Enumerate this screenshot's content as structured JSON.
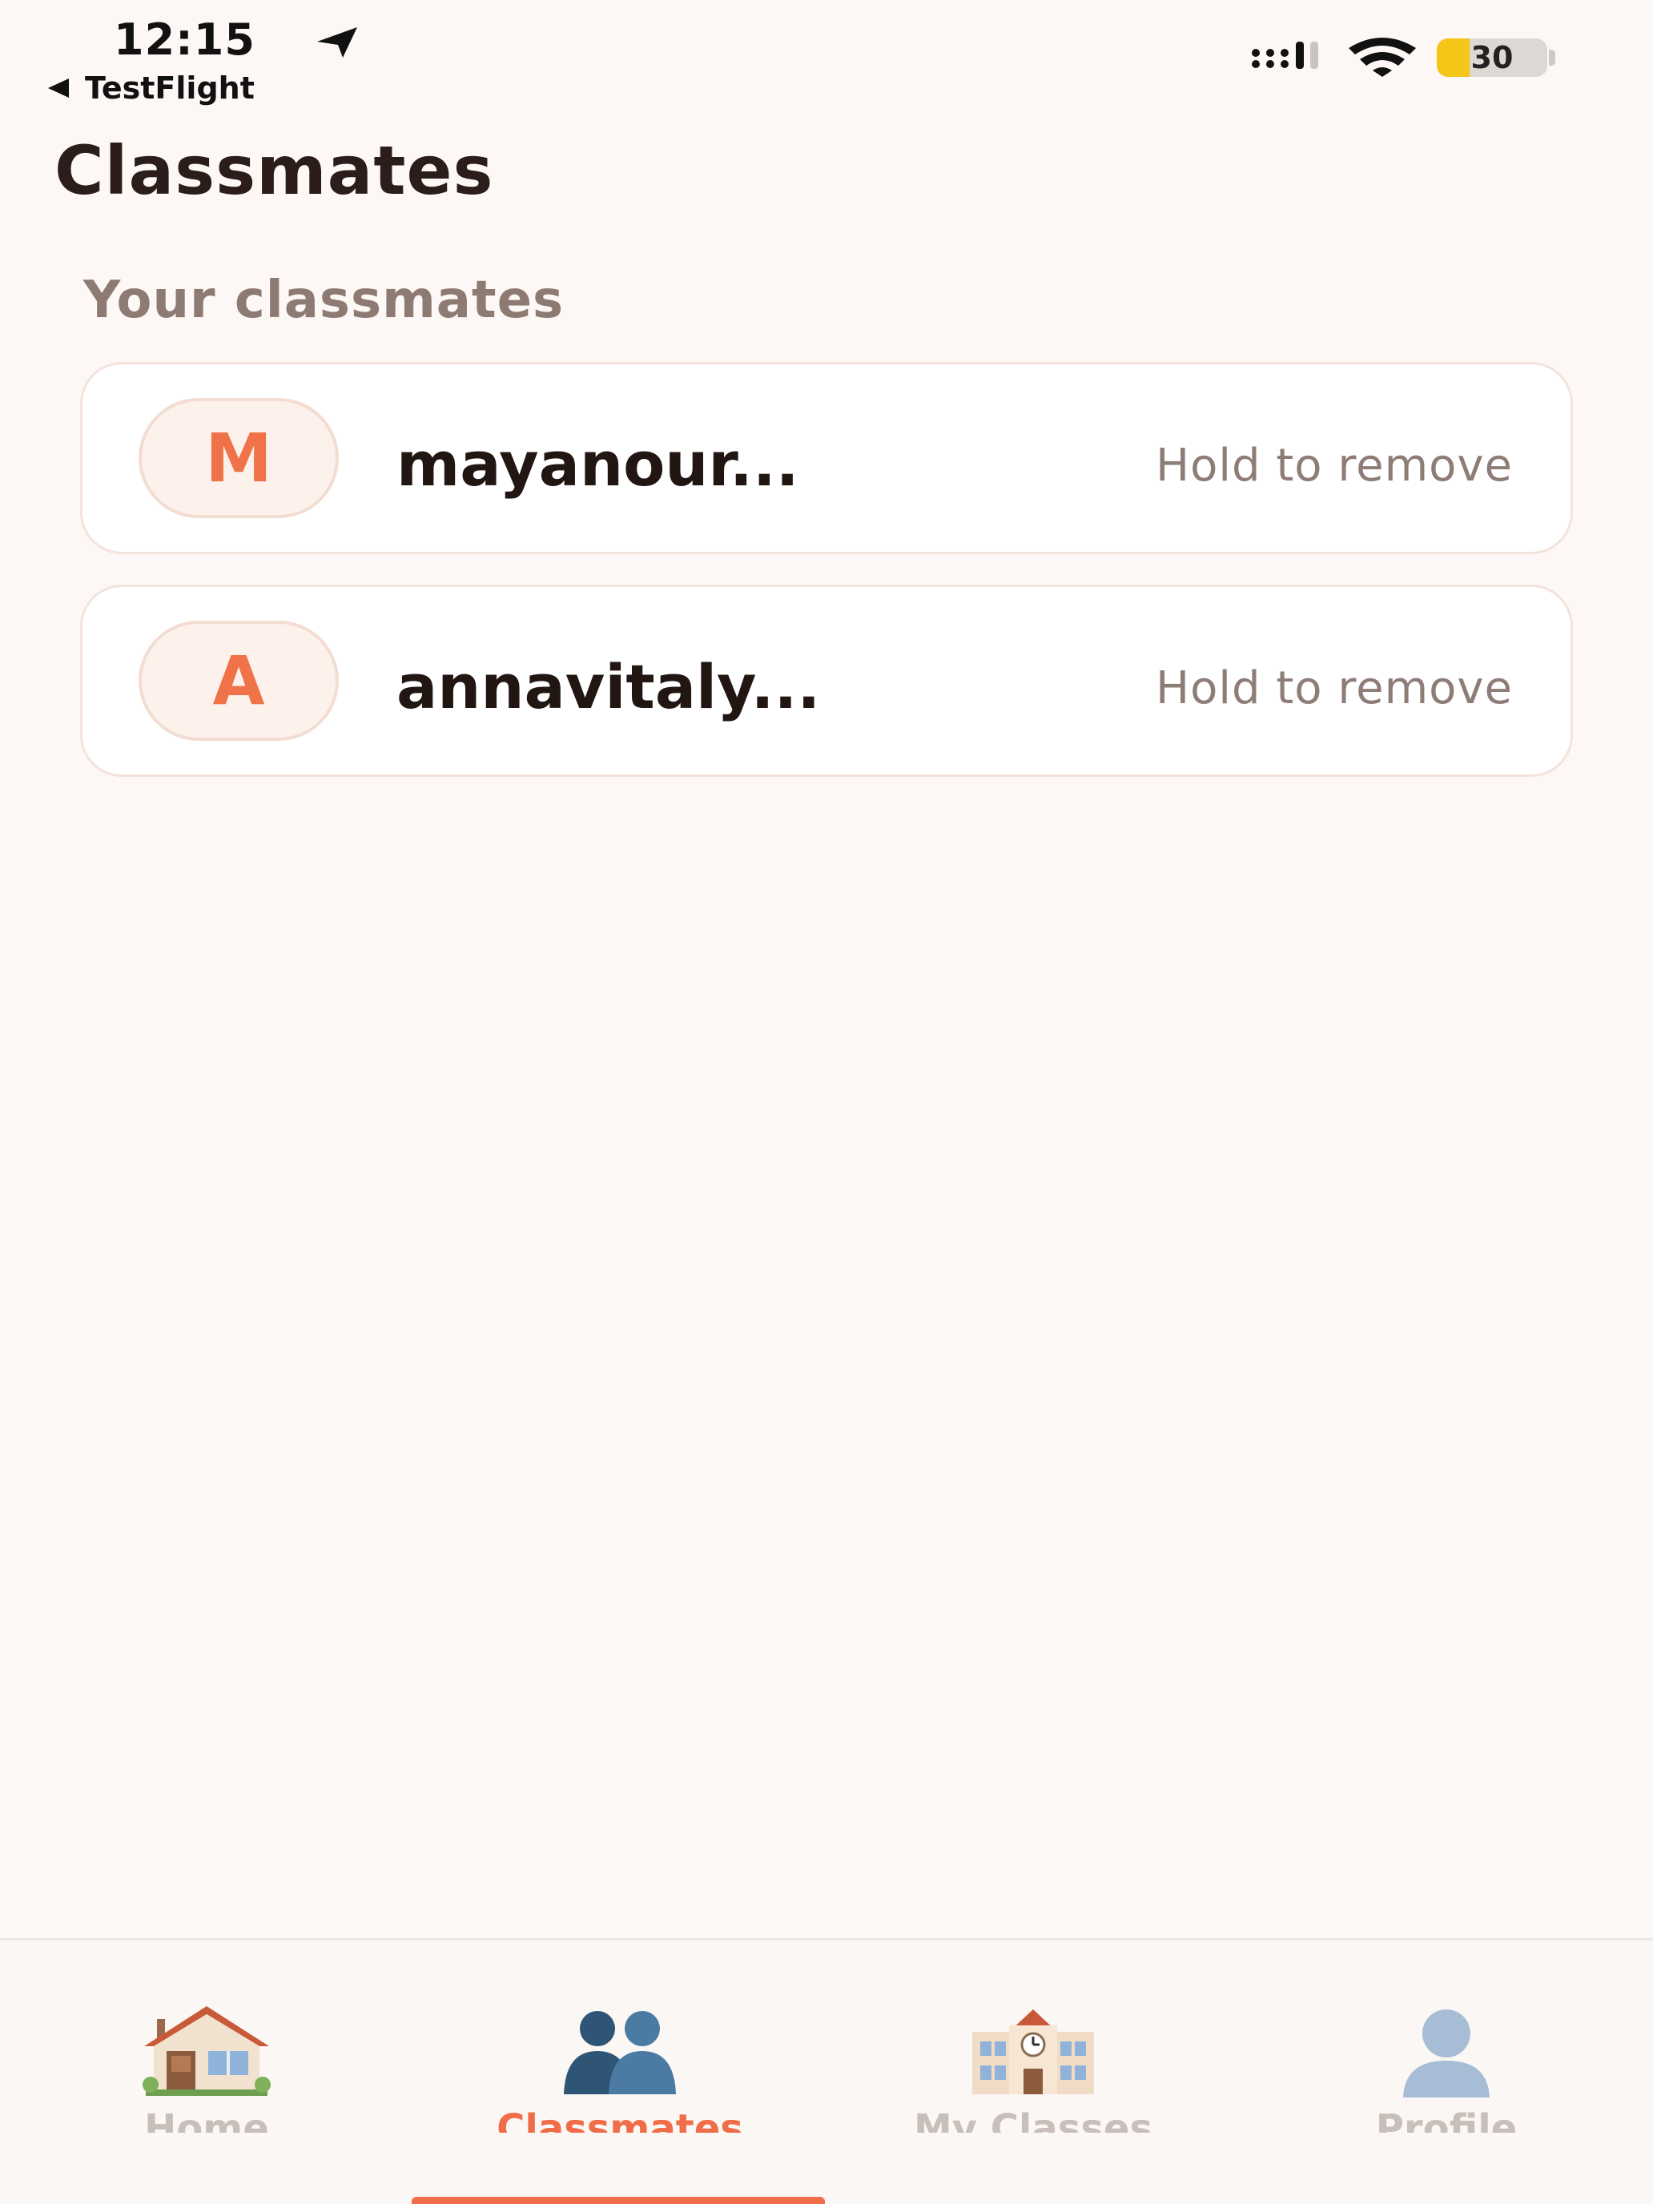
{
  "status_bar": {
    "time": "12:15",
    "back_app": "TestFlight",
    "battery_level": "30",
    "battery_fraction": 0.3,
    "icons": [
      "location-arrow-icon",
      "signal-icon",
      "wifi-icon",
      "battery-icon"
    ]
  },
  "header": {
    "title": "Classmates"
  },
  "section": {
    "label": "Your classmates"
  },
  "classmates": [
    {
      "initial": "M",
      "name": "mayanour...",
      "hint": "Hold to remove"
    },
    {
      "initial": "A",
      "name": "annavitaly...",
      "hint": "Hold to remove"
    }
  ],
  "tab_bar": {
    "tabs": [
      {
        "label": "Home",
        "icon": "house-icon"
      },
      {
        "label": "Classmates",
        "icon": "people-icon",
        "active": true
      },
      {
        "label": "My Classes",
        "icon": "school-building-icon"
      },
      {
        "label": "Profile",
        "icon": "person-silhouette-icon"
      }
    ]
  },
  "colors": {
    "background": "#fdf8f5",
    "accent": "#f06d4a",
    "title": "#2b1d19",
    "muted": "#8d7a72",
    "card_border": "#f4e3dc",
    "battery": "#f5c518"
  }
}
